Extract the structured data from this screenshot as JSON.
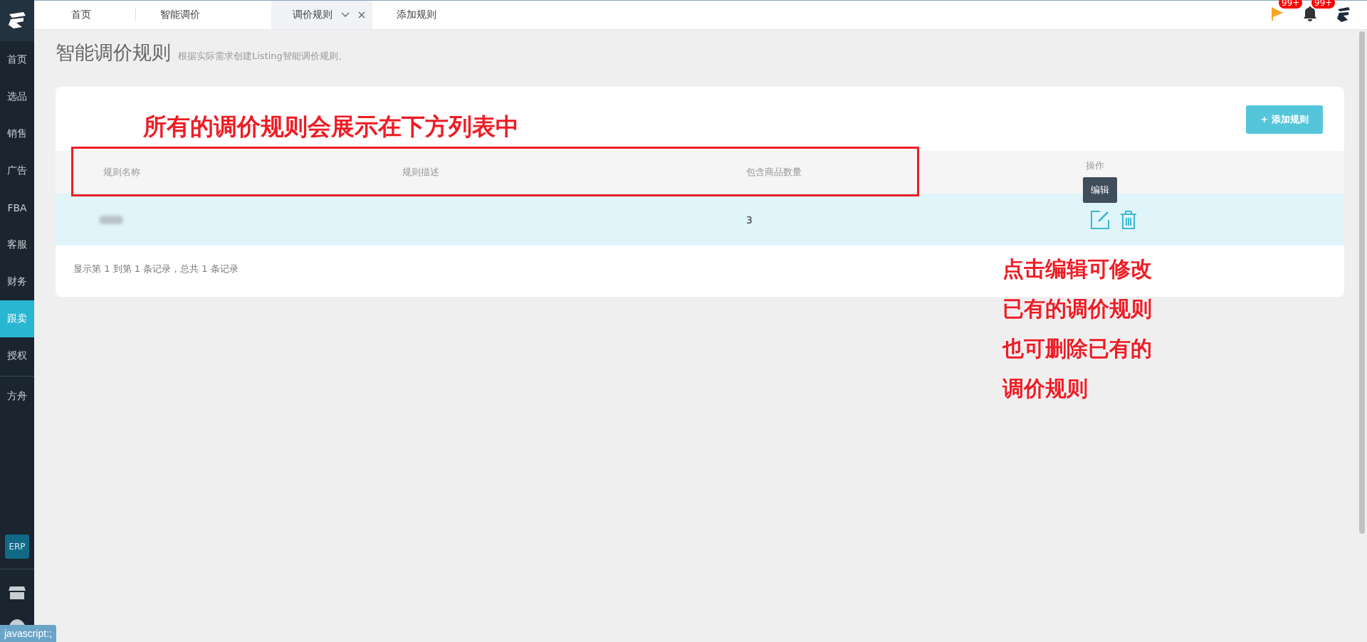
{
  "sidebar": {
    "items": [
      {
        "label": "首页",
        "selected": false
      },
      {
        "label": "选品",
        "selected": false
      },
      {
        "label": "销售",
        "selected": false
      },
      {
        "label": "广告",
        "selected": false
      },
      {
        "label": "FBA",
        "selected": false
      },
      {
        "label": "客服",
        "selected": false
      },
      {
        "label": "财务",
        "selected": false
      },
      {
        "label": "跟卖",
        "selected": true
      },
      {
        "label": "授权",
        "selected": false
      },
      {
        "label": "方舟",
        "selected": false
      }
    ],
    "erp_label": "ERP"
  },
  "tabs": [
    {
      "label": "首页",
      "selected": false,
      "closable": false
    },
    {
      "label": "智能调价",
      "selected": false,
      "closable": false
    },
    {
      "label": "调价规则",
      "selected": true,
      "closable": true
    },
    {
      "label": "添加规则",
      "selected": false,
      "closable": false
    }
  ],
  "notifications": [
    {
      "kind": "flag",
      "badge": "99+"
    },
    {
      "kind": "bell",
      "badge": "99+"
    }
  ],
  "page": {
    "title": "智能调价规则",
    "subtitle": "根据实际需求创建Listing智能调价规则。"
  },
  "add_button": "+ 添加规则",
  "table": {
    "columns": [
      "规则名称",
      "规则描述",
      "包含商品数量",
      "操作"
    ],
    "rows": [
      {
        "count": "3",
        "highlighted": true
      }
    ]
  },
  "tooltip": "编辑",
  "pagination_info": "显示第 1 到第 1 条记录，总共 1 条记录",
  "annotations": [
    {
      "text": "所有的调价规则会展示在下方列表中"
    },
    {
      "text": "点击编辑可修改已有的调价规则也可删除已有的调价规则"
    }
  ],
  "status_bar": "javascript:;"
}
